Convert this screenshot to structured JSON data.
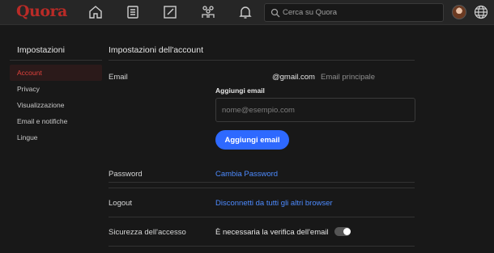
{
  "header": {
    "logo": "Quora",
    "nav": [
      "home-icon",
      "answer-icon",
      "write-icon",
      "spaces-icon",
      "notifications-icon"
    ],
    "search_placeholder": "Cerca su Quora"
  },
  "sidebar": {
    "title": "Impostazioni",
    "items": [
      {
        "label": "Account"
      },
      {
        "label": "Privacy"
      },
      {
        "label": "Visualizzazione"
      },
      {
        "label": "Email e notifiche"
      },
      {
        "label": "Lingue"
      }
    ]
  },
  "main": {
    "title": "Impostazioni dell'account",
    "email": {
      "label": "Email",
      "address": "@gmail.com",
      "primary": "Email principale",
      "add_label": "Aggiungi email",
      "add_placeholder": "nome@esempio.com",
      "add_button": "Aggiungi email"
    },
    "password": {
      "label": "Password",
      "action": "Cambia Password"
    },
    "logout": {
      "label": "Logout",
      "action": "Disconnetti da tutti gli altri browser"
    },
    "security": {
      "label": "Sicurezza dell'accesso",
      "value": "È necessaria la verifica dell'email",
      "toggle_on": false
    }
  },
  "colors": {
    "brand": "#b92b27",
    "accent": "#2e69ff",
    "link": "#4d8bff"
  }
}
